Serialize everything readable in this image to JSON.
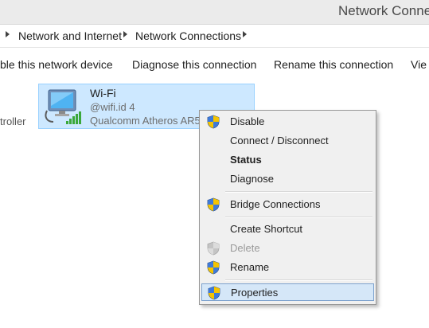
{
  "window": {
    "title": "Network Connections"
  },
  "breadcrumb": [
    "Network and Internet",
    "Network Connections"
  ],
  "commands": {
    "disable": "ble this network device",
    "diagnose": "Diagnose this connection",
    "rename": "Rename this connection",
    "view": "Vie"
  },
  "sidebar_partial_text": "troller",
  "adapter": {
    "name": "Wi-Fi",
    "ssid": "@wifi.id  4",
    "hardware": "Qualcomm Atheros AR5"
  },
  "context_menu": {
    "items": [
      {
        "label": "Disable",
        "shield": true
      },
      {
        "label": "Connect / Disconnect",
        "shield": false
      },
      {
        "label": "Status",
        "shield": false,
        "bold": true
      },
      {
        "label": "Diagnose",
        "shield": false
      },
      {
        "label": "Bridge Connections",
        "shield": true
      },
      {
        "label": "Create Shortcut",
        "shield": false
      },
      {
        "label": "Delete",
        "shield": true,
        "disabled": true
      },
      {
        "label": "Rename",
        "shield": true
      },
      {
        "label": "Properties",
        "shield": true,
        "highlighted": true
      }
    ]
  },
  "colors": {
    "selection_fill": "#cde8ff",
    "selection_border": "#99d1ff",
    "menu_bg": "#f0f0f0",
    "menu_highlight": "#d5e7f8",
    "signal_green": "#3aa83a"
  }
}
